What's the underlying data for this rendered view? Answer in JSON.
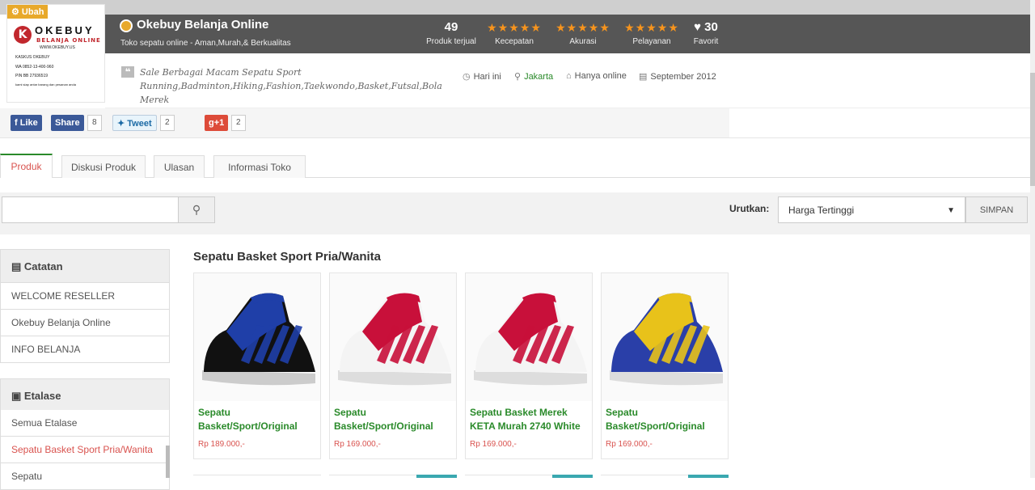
{
  "logo": {
    "ubah_label": "Ubah",
    "brand_letter": "K",
    "brand_name": "OKEBUY",
    "brand_sub": "BELANJA ONLINE",
    "lines": [
      "WWW.OKEBUY.US",
      "KASKUS      OKEBUY",
      "WA          0852-13-400-960",
      "PIN BB      27936519",
      "kami siap antar barang dan pesanan anda"
    ]
  },
  "header": {
    "shop_name": "Okebuy Belanja Online",
    "tagline": "Toko sepatu online - Aman,Murah,& Berkualitas",
    "stats": [
      {
        "value": "49",
        "label": "Produk terjual"
      },
      {
        "stars": "★★★★★",
        "label": "Kecepatan"
      },
      {
        "stars": "★★★★★",
        "label": "Akurasi"
      },
      {
        "stars": "★★★★★",
        "label": "Pelayanan"
      },
      {
        "value": "♥ 30",
        "label": "Favorit"
      }
    ]
  },
  "info": {
    "description": "Sale Berbagai Macam Sepatu Sport Running,Badminton,Hiking,Fashion,Taekwondo,Basket,Futsal,Bola Merek",
    "meta": [
      {
        "icon": "clock-icon",
        "glyph": "◷",
        "text": "Hari ini"
      },
      {
        "icon": "location-icon",
        "glyph": "⚲",
        "text": "Jakarta"
      },
      {
        "icon": "home-icon",
        "glyph": "⌂",
        "text": "Hanya online"
      },
      {
        "icon": "calendar-icon",
        "glyph": "▤",
        "text": "September 2012"
      }
    ]
  },
  "social": {
    "like": "Like",
    "share": "Share",
    "share_count": "8",
    "tweet": "Tweet",
    "tweet_count": "2",
    "gplus": "g+1",
    "gplus_count": "2"
  },
  "tabs": [
    "Produk",
    "Diskusi Produk",
    "Ulasan",
    "Informasi Toko"
  ],
  "search": {
    "placeholder": "",
    "sort_label": "Urutkan:",
    "sort_value": "Harga Tertinggi",
    "save_label": "SIMPAN"
  },
  "sidebar": {
    "catatan_title": "Catatan",
    "catatan_items": [
      "WELCOME RESELLER",
      "Okebuy Belanja Online",
      "INFO BELANJA"
    ],
    "etalase_title": "Etalase",
    "etalase_items": [
      "Semua Etalase",
      "Sepatu Basket Sport Pria/Wanita",
      "Sepatu"
    ]
  },
  "section_title": "Sepatu Basket Sport Pria/Wanita",
  "products": [
    {
      "name": "Sepatu Basket/Sport/Original",
      "price": "Rp 189.000,-",
      "colors": [
        "#1f3fa8",
        "#111111",
        "#cccccc"
      ]
    },
    {
      "name": "Sepatu Basket/Sport/Original",
      "price": "Rp 169.000,-",
      "colors": [
        "#c8103a",
        "#f4f4f4",
        "#dddddd"
      ]
    },
    {
      "name": "Sepatu Basket Merek KETA Murah 2740 White",
      "price": "Rp 169.000,-",
      "colors": [
        "#c8103a",
        "#f4f4f4",
        "#dddddd"
      ]
    },
    {
      "name": "Sepatu Basket/Sport/Original",
      "price": "Rp 169.000,-",
      "colors": [
        "#e8c21a",
        "#2a3fa8",
        "#dddddd"
      ]
    }
  ]
}
